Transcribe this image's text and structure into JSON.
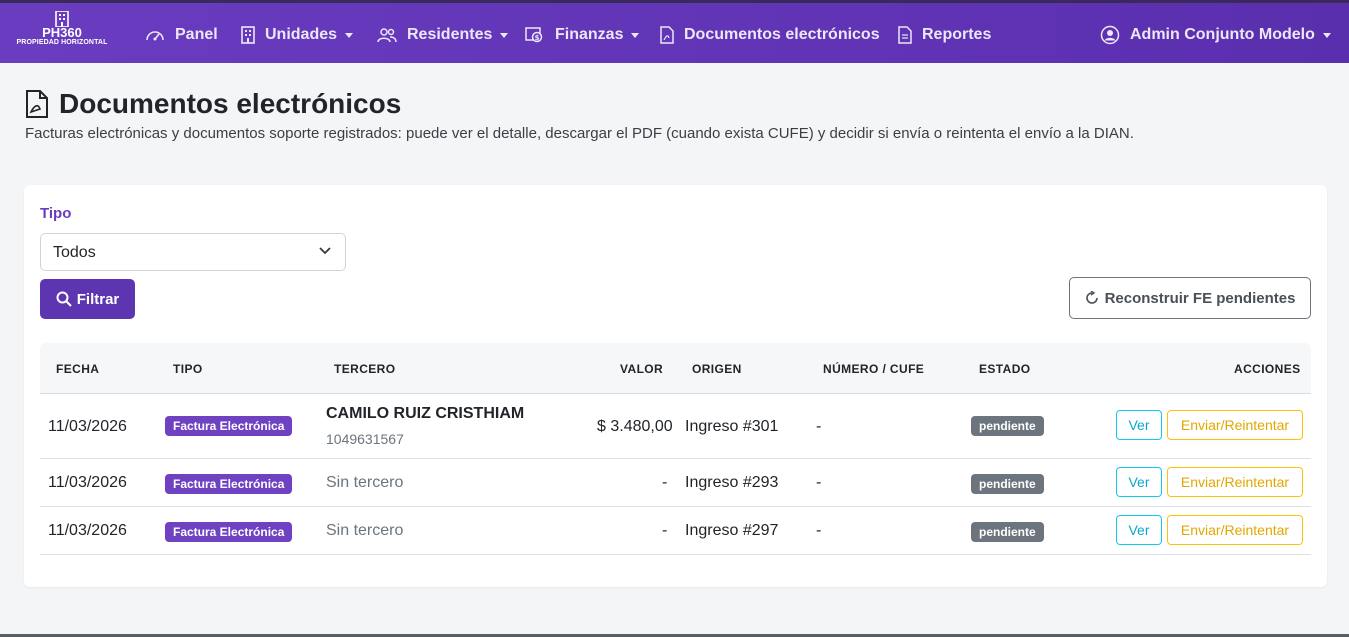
{
  "brand": {
    "name": "PH360",
    "tagline": "PROPIEDAD HORIZONTAL"
  },
  "nav": {
    "items": [
      {
        "label": "Panel",
        "icon": "gauge-icon",
        "dropdown": false
      },
      {
        "label": "Unidades",
        "icon": "building-icon",
        "dropdown": true
      },
      {
        "label": "Residentes",
        "icon": "people-icon",
        "dropdown": true
      },
      {
        "label": "Finanzas",
        "icon": "cash-icon",
        "dropdown": true
      },
      {
        "label": "Documentos electrónicos",
        "icon": "file-pdf-icon",
        "dropdown": false
      },
      {
        "label": "Reportes",
        "icon": "file-text-icon",
        "dropdown": false
      }
    ],
    "user": {
      "label": "Admin Conjunto Modelo",
      "icon": "user-circle-icon"
    }
  },
  "page": {
    "title": "Documentos electrónicos",
    "subtitle": "Facturas electrónicas y documentos soporte registrados: puede ver el detalle, descargar el PDF (cuando exista CUFE) y decidir si envía o reintenta el envío a la DIAN."
  },
  "filter": {
    "label": "Tipo",
    "selected": "Todos",
    "filter_button": "Filtrar",
    "rebuild_button": "Reconstruir FE pendientes"
  },
  "table": {
    "headers": [
      "FECHA",
      "TIPO",
      "TERCERO",
      "VALOR",
      "ORIGEN",
      "NÚMERO / CUFE",
      "ESTADO",
      "ACCIONES"
    ],
    "rows": [
      {
        "fecha": "11/03/2026",
        "tipo": "Factura Electrónica",
        "tercero": "CAMILO RUIZ CRISTHIAM",
        "tercero_id": "1049631567",
        "valor": "$ 3.480,00",
        "origen": "Ingreso #301",
        "numero": "-",
        "estado": "pendiente",
        "ver": "Ver",
        "enviar": "Enviar/Reintentar"
      },
      {
        "fecha": "11/03/2026",
        "tipo": "Factura Electrónica",
        "tercero": "Sin tercero",
        "tercero_id": "",
        "valor": "-",
        "origen": "Ingreso #293",
        "numero": "-",
        "estado": "pendiente",
        "ver": "Ver",
        "enviar": "Enviar/Reintentar"
      },
      {
        "fecha": "11/03/2026",
        "tipo": "Factura Electrónica",
        "tercero": "Sin tercero",
        "tercero_id": "",
        "valor": "-",
        "origen": "Ingreso #297",
        "numero": "-",
        "estado": "pendiente",
        "ver": "Ver",
        "enviar": "Enviar/Reintentar"
      }
    ]
  },
  "colors": {
    "primary": "#6a3cc0",
    "badge_type": "#6f42c1",
    "badge_state": "#6c757d",
    "info": "#0dcaf0",
    "warning": "#ffc107"
  }
}
